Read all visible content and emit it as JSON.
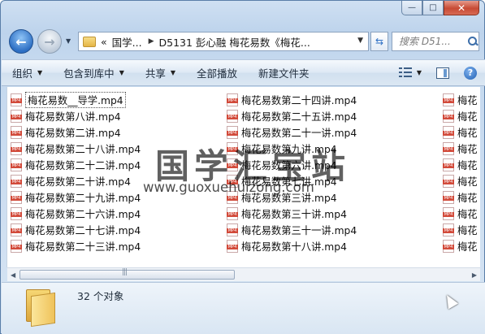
{
  "window": {
    "minimize_glyph": "—",
    "maximize_glyph": "□",
    "close_glyph": "✕"
  },
  "nav": {
    "back_glyph": "←",
    "forward_glyph": "→",
    "address_segments": [
      "«",
      "国学...",
      "D5131 彭心融 梅花易数《梅花..."
    ],
    "refresh_glyph": "⇆",
    "search_placeholder": "搜索 D51..."
  },
  "toolbar": {
    "organize": "组织",
    "include_library": "包含到库中",
    "share": "共享",
    "play_all": "全部播放",
    "new_folder": "新建文件夹",
    "help": "?"
  },
  "files": {
    "col1": [
      "梅花易数__导学.mp4",
      "梅花易数第八讲.mp4",
      "梅花易数第二讲.mp4",
      "梅花易数第二十八讲.mp4",
      "梅花易数第二十二讲.mp4",
      "梅花易数第二十讲.mp4",
      "梅花易数第二十九讲.mp4",
      "梅花易数第二十六讲.mp4",
      "梅花易数第二十七讲.mp4",
      "梅花易数第二十三讲.mp4"
    ],
    "col2": [
      "梅花易数第二十四讲.mp4",
      "梅花易数第二十五讲.mp4",
      "梅花易数第二十一讲.mp4",
      "梅花易数第九讲.mp4",
      "梅花易数第六讲.mp4",
      "梅花易数第七讲.mp4",
      "梅花易数第三讲.mp4",
      "梅花易数第三十讲.mp4",
      "梅花易数第三十一讲.mp4",
      "梅花易数第十八讲.mp4"
    ],
    "col3": [
      "梅花",
      "梅花",
      "梅花",
      "梅花",
      "梅花",
      "梅花",
      "梅花",
      "梅花",
      "梅花",
      "梅花"
    ]
  },
  "status": {
    "count": "32 个对象"
  },
  "watermark": {
    "title": "国学汇宝站",
    "url": "www.guoxuehuizong.com"
  }
}
